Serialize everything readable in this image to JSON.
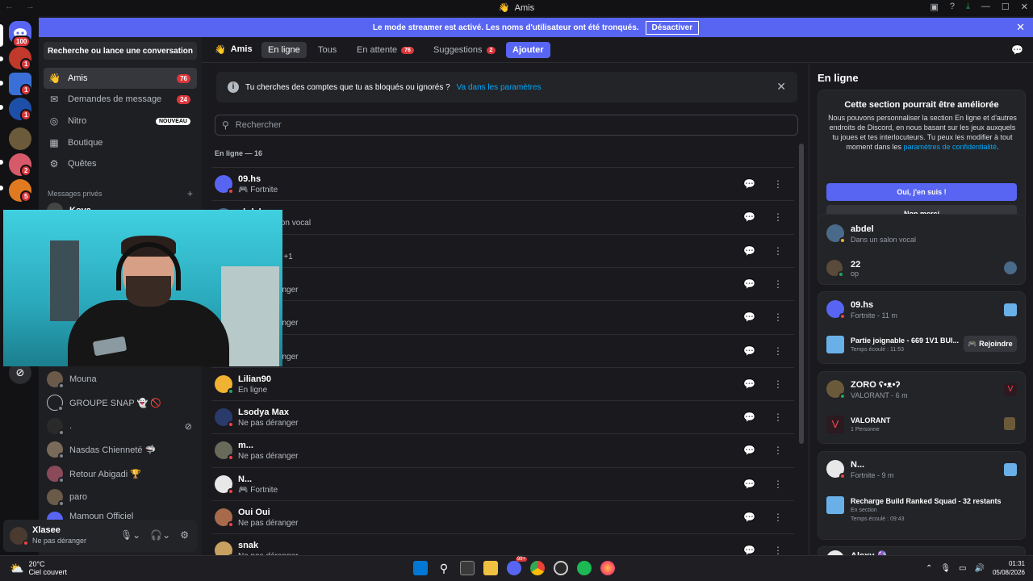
{
  "titlebar": {
    "title": "Amis"
  },
  "banner": {
    "text": "Le mode streamer est activé. Les noms d'utilisateur ont été tronqués.",
    "button": "Désactiver"
  },
  "rail": {
    "home_badge": "100",
    "servers": [
      {
        "badge": "1",
        "color": "#c0392b"
      },
      {
        "badge": "1",
        "color": "#3b6fd8"
      },
      {
        "badge": "1",
        "color": "#1e4fa8"
      },
      {
        "badge": "",
        "color": "#6b5b3a"
      },
      {
        "badge": "2",
        "color": "#d65a6a"
      },
      {
        "badge": "5",
        "color": "#e07a20"
      }
    ]
  },
  "sidebar": {
    "search_label": "Recherche ou lance une conversation",
    "nav": [
      {
        "label": "Amis",
        "count": "76"
      },
      {
        "label": "Demandes de message",
        "count": "24"
      },
      {
        "label": "Nitro",
        "tag": "NOUVEAU"
      },
      {
        "label": "Boutique"
      },
      {
        "label": "Quêtes"
      }
    ],
    "dm_header": "Messages privés",
    "dms": [
      {
        "name": "Koya"
      },
      {
        "name": "Mouna"
      },
      {
        "name": "GROUPE SNAP 👻 🚫"
      },
      {
        "name": "."
      },
      {
        "name": "Nasdas Chienneté 🦈"
      },
      {
        "name": "Retour Abigadi 🏆"
      },
      {
        "name": "paro"
      },
      {
        "name": "Mamoun Officiel"
      }
    ]
  },
  "user": {
    "name": "Xlasee",
    "status": "Ne pas déranger"
  },
  "header": {
    "title": "Amis",
    "tabs": [
      {
        "label": "En ligne"
      },
      {
        "label": "Tous"
      },
      {
        "label": "En attente",
        "count": "76"
      },
      {
        "label": "Suggestions",
        "count": "2"
      },
      {
        "label": "Ajouter"
      }
    ]
  },
  "notice": {
    "text": "Tu cherches des comptes que tu as bloqués ou ignorés ?",
    "link": "Va dans les paramètres"
  },
  "search": {
    "placeholder": "Rechercher"
  },
  "online_header": "En ligne — 16",
  "friends": [
    {
      "name": "09.hs",
      "sub": "🎮 Fortnite",
      "color": "#5865f2"
    },
    {
      "name": "abdel",
      "sub": "Dans un salon vocal",
      "color": "#4a6a8a"
    },
    {
      "name": "",
      "sub": "Tracker App +1",
      "color": "#6a6a6a"
    },
    {
      "name": "",
      "sub": "Ne pas déranger",
      "color": "#7a5a4a"
    },
    {
      "name": "",
      "sub": "Ne pas déranger",
      "color": "#5a5a5a"
    },
    {
      "name": "",
      "sub": "Ne pas déranger",
      "color": "#4a4a5a"
    },
    {
      "name": "Lilian90",
      "sub": "En ligne",
      "color": "#f0b232"
    },
    {
      "name": "Lsodya Max",
      "sub": "Ne pas déranger",
      "color": "#2a3a6a"
    },
    {
      "name": "m...",
      "sub": "Ne pas déranger",
      "color": "#6a6a5a"
    },
    {
      "name": "N...",
      "sub": "🎮 Fortnite",
      "color": "#e8e8e8"
    },
    {
      "name": "Oui Oui",
      "sub": "Ne pas déranger",
      "color": "#a86a4a"
    },
    {
      "name": "snak",
      "sub": "Ne pas déranger",
      "color": "#c8a060"
    }
  ],
  "right": {
    "title": "En ligne",
    "promo": {
      "title": "Cette section pourrait être améliorée",
      "body": "Nous pouvons personnaliser la section En ligne et d'autres endroits de Discord, en nous basant sur les jeux auxquels tu joues et tes interlocuteurs. Tu peux les modifier à tout moment dans les",
      "link": "paramètres de confidentialité",
      "end": ".",
      "yes": "Oui, j'en suis !",
      "no": "Non merci"
    },
    "activities": [
      {
        "name": "abdel",
        "sub": "Dans un salon vocal",
        "sub_name": "22",
        "sub_sub": "op"
      },
      {
        "name": "09.hs",
        "sub": "Fortnite - 11 m",
        "detail": "Partie joignable - 669 1V1 BUI...",
        "detail_sub": "Temps écoulé : 11:53",
        "button": "Rejoindre"
      },
      {
        "name": "ZORO ʕ•ᴥ•ʔ",
        "sub": "VALORANT - 6 m",
        "detail": "VALORANT",
        "detail_sub": "1 Personne"
      },
      {
        "name": "N...",
        "sub": "Fortnite - 9 m",
        "detail": "Recharge Build Ranked Squad - 32 restants",
        "detail_sub": "En section",
        "detail_sub2": "Temps écoulé : 09:43"
      },
      {
        "name": "Alexy 🔮"
      }
    ]
  },
  "taskbar": {
    "temp": "20°C",
    "weather": "Ciel couvert",
    "time": "01:31",
    "date": "05/08/2026",
    "discord_badge": "99+"
  }
}
